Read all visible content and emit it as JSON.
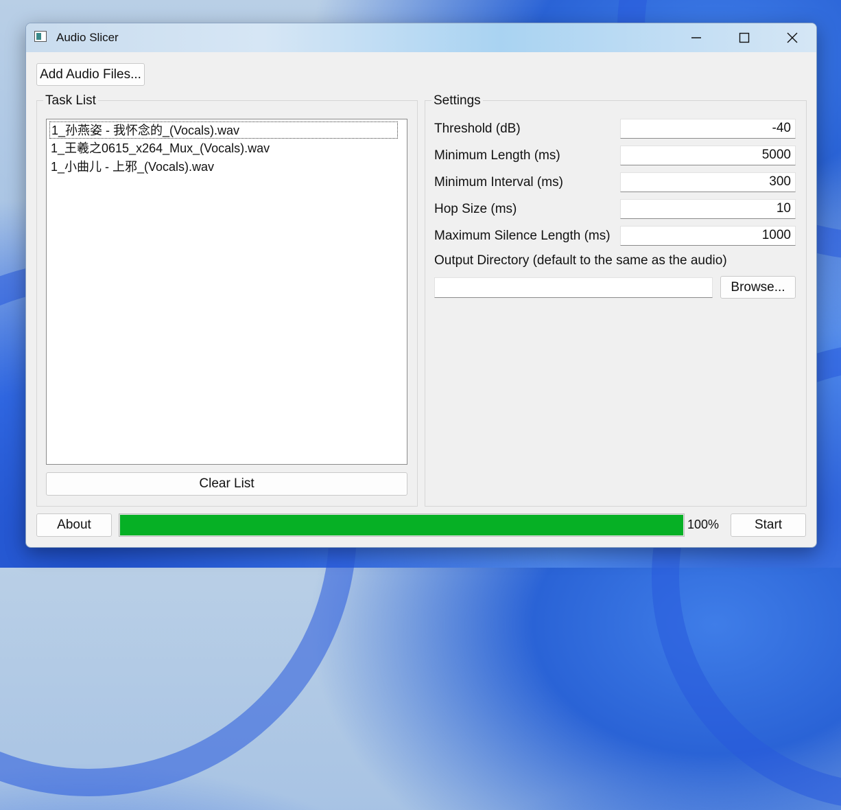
{
  "window": {
    "title": "Audio Slicer",
    "minimize_icon": "minimize-icon",
    "maximize_icon": "maximize-icon",
    "close_icon": "close-icon"
  },
  "toolbar": {
    "add_files_label": "Add Audio Files..."
  },
  "task_list": {
    "title": "Task List",
    "items": [
      "1_孙燕姿 - 我怀念的_(Vocals).wav",
      "1_王羲之0615_x264_Mux_(Vocals).wav",
      "1_小曲儿 - 上邪_(Vocals).wav"
    ],
    "clear_label": "Clear List"
  },
  "settings": {
    "title": "Settings",
    "threshold_label": "Threshold (dB)",
    "threshold_value": "-40",
    "min_length_label": "Minimum Length (ms)",
    "min_length_value": "5000",
    "min_interval_label": "Minimum Interval (ms)",
    "min_interval_value": "300",
    "hop_size_label": "Hop Size (ms)",
    "hop_size_value": "10",
    "max_silence_label": "Maximum Silence Length (ms)",
    "max_silence_value": "1000",
    "output_dir_label": "Output Directory (default to the same as the audio)",
    "output_dir_value": "",
    "browse_label": "Browse..."
  },
  "footer": {
    "about_label": "About",
    "progress_value": 100,
    "progress_text": "100%",
    "start_label": "Start"
  },
  "colors": {
    "progress": "#06b025",
    "window_bg": "#f0f0f0"
  }
}
